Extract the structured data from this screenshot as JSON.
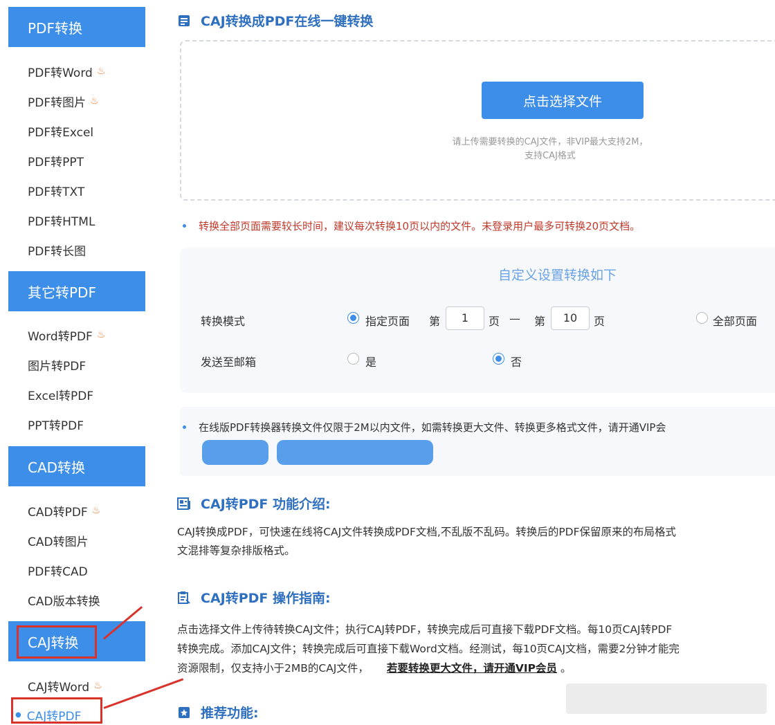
{
  "sidebar": {
    "categories": [
      {
        "label": "PDF转换",
        "items": [
          {
            "label": "PDF转Word",
            "hot": true
          },
          {
            "label": "PDF转图片",
            "hot": true
          },
          {
            "label": "PDF转Excel",
            "hot": false
          },
          {
            "label": "PDF转PPT",
            "hot": false
          },
          {
            "label": "PDF转TXT",
            "hot": false
          },
          {
            "label": "PDF转HTML",
            "hot": false
          },
          {
            "label": "PDF转长图",
            "hot": false
          }
        ]
      },
      {
        "label": "其它转PDF",
        "items": [
          {
            "label": "Word转PDF",
            "hot": true
          },
          {
            "label": "图片转PDF",
            "hot": false
          },
          {
            "label": "Excel转PDF",
            "hot": false
          },
          {
            "label": "PPT转PDF",
            "hot": false
          }
        ]
      },
      {
        "label": "CAD转换",
        "items": [
          {
            "label": "CAD转PDF",
            "hot": true
          },
          {
            "label": "CAD转图片",
            "hot": false
          },
          {
            "label": "PDF转CAD",
            "hot": false
          },
          {
            "label": "CAD版本转换",
            "hot": false
          }
        ]
      },
      {
        "label": "CAJ转换",
        "items": [
          {
            "label": "CAJ转Word",
            "hot": true
          },
          {
            "label": "CAJ转PDF",
            "hot": false,
            "active": true
          }
        ]
      }
    ],
    "fire_icon": "fire-icon"
  },
  "main": {
    "title": "CAJ转换成PDF在线一键转换",
    "upload": {
      "button": "点击选择文件",
      "hint_line1": "请上传需要转换的CAJ文件，非VIP最大支持2M，",
      "hint_line2": "支持CAJ格式"
    },
    "notice1": "转换全部页面需要较长时间，建议每次转换10页以内的文件。未登录用户最多可转换20页文档。",
    "settings": {
      "title": "自定义设置转换如下",
      "mode_label": "转换模式",
      "mode_specified": "指定页面",
      "page_prefix": "第",
      "from_page": "1",
      "page_suffix": "页",
      "dash": "—",
      "to_page": "10",
      "mode_all": "全部页面",
      "email_label": "发送至邮箱",
      "yes": "是",
      "no": "否"
    },
    "notice2": "在线版PDF转换器转换文件仅限于2M以内文件，如需转换更大文件、转换更多格式文件，请开通VIP会",
    "intro": {
      "title": "CAJ转PDF 功能介绍:",
      "line1": "CAJ转换成PDF，可快速在线将CAJ文件转换成PDF文档,不乱版不乱码。转换后的PDF保留原来的布局格式",
      "line2": "文混排等复杂排版格式。"
    },
    "guide": {
      "title": "CAJ转PDF 操作指南:",
      "line1": "点击选择文件上传待转换CAJ文件；执行CAJ转PDF，转换完成后可直接下载PDF文档。每10页CAJ转PDF",
      "line2": "转换完成。添加CAJ文件；转换完成后可直接下载Word文档。经测试，每10页CAJ文档，需要2分钟才能完",
      "line3": "资源限制，仅支持小于2MB的CAJ文件，",
      "vip_link": "若要转换更大文件，请开通VIP会员",
      "tail": "。"
    },
    "recommend": {
      "title": "推荐功能:"
    }
  },
  "colors": {
    "accent": "#3d8ee8",
    "notice_red": "#c0392b",
    "annotation_red": "#d9322b"
  }
}
